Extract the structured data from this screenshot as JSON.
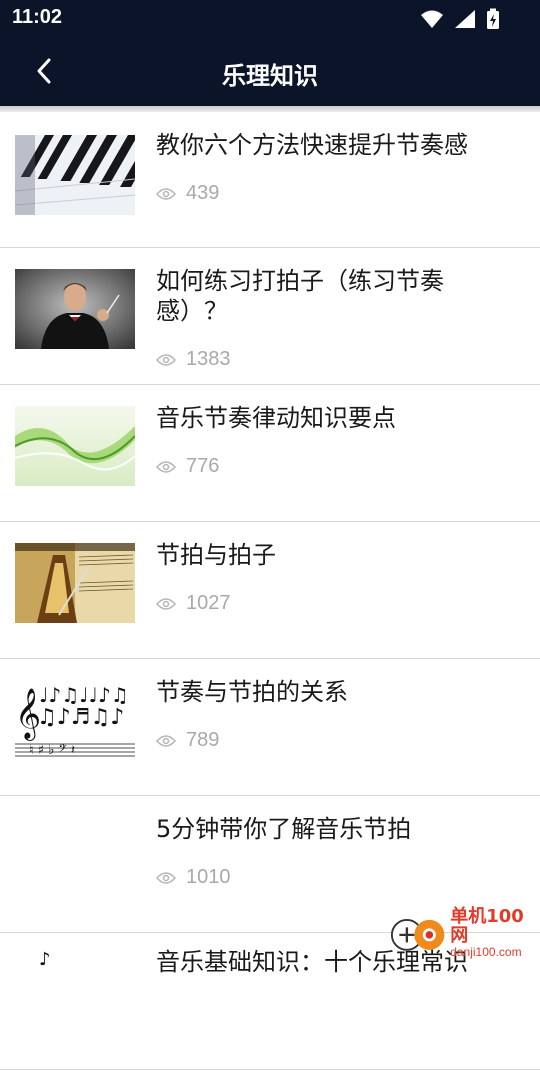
{
  "status": {
    "time": "11:02"
  },
  "header": {
    "title": "乐理知识"
  },
  "icons": {
    "back": "back-arrow-icon",
    "views": "eye-icon",
    "wifi": "wifi-icon",
    "signal": "signal-icon",
    "battery": "battery-charging-icon"
  },
  "colors": {
    "header_bg": "#0b1428",
    "meta_text": "#a9a9a9"
  },
  "articles": [
    {
      "title": "教你六个方法快速提升节奏感",
      "views": "439",
      "thumbnail": "piano-keys"
    },
    {
      "title": "如何练习打拍子（练习节奏感）？",
      "views": "1383",
      "thumbnail": "conductor"
    },
    {
      "title": "音乐节奏律动知识要点",
      "views": "776",
      "thumbnail": "green-waves"
    },
    {
      "title": "节拍与拍子",
      "views": "1027",
      "thumbnail": "metronome"
    },
    {
      "title": "节奏与节拍的关系",
      "views": "789",
      "thumbnail": "music-notes"
    },
    {
      "title": "5分钟带你了解音乐节拍",
      "views": "1010",
      "thumbnail": "none"
    },
    {
      "title": "音乐基础知识：十个乐理常识",
      "views": "",
      "thumbnail": "music-notes"
    }
  ],
  "watermark": {
    "brand": "单机100网",
    "url": "danji100.com"
  }
}
